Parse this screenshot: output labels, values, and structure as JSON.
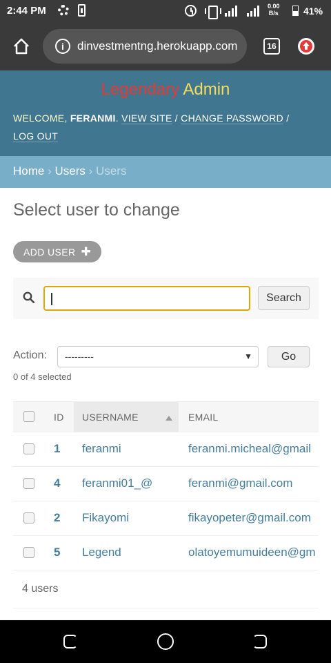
{
  "status": {
    "time": "2:44 PM",
    "net_speed_value": "0.00",
    "net_speed_unit": "B/s",
    "battery": "41%"
  },
  "browser": {
    "url": "dinvestmentng.herokuapp.com",
    "tab_count": "16"
  },
  "header": {
    "brand_part1": "Legendary",
    "brand_part2": "Admin",
    "welcome": "WELCOME, ",
    "username": "FERANMI",
    "view_site": "VIEW SITE",
    "change_password": "CHANGE PASSWORD",
    "log_out": "LOG OUT",
    "separator": " / "
  },
  "breadcrumbs": {
    "home": "Home",
    "app": "Users",
    "current": "Users",
    "sep": "›"
  },
  "page": {
    "title": "Select user to change",
    "add_button": "ADD USER",
    "add_plus": "✚"
  },
  "search": {
    "value": "",
    "button": "Search"
  },
  "actions": {
    "label": "Action:",
    "selected": "---------",
    "go": "Go",
    "selected_count": "0 of 4 selected"
  },
  "table": {
    "columns": [
      "ID",
      "USERNAME",
      "EMAIL"
    ],
    "rows": [
      {
        "id": "1",
        "username": "feranmi",
        "email": "feranmi.micheal@gmail"
      },
      {
        "id": "4",
        "username": "feranmi01_@",
        "email": "feranmi@gmail.com"
      },
      {
        "id": "2",
        "username": "Fikayomi",
        "email": "fikayopeter@gmail.com"
      },
      {
        "id": "5",
        "username": "Legend",
        "email": "olatoyemumuideen@gm"
      }
    ],
    "footer": "4 users"
  },
  "colors": {
    "header_bg": "#417690",
    "breadcrumb_bg": "#79aec8",
    "link": "#447e9b",
    "brand_red": "#e53935",
    "brand_yellow": "#f5dd5d"
  }
}
